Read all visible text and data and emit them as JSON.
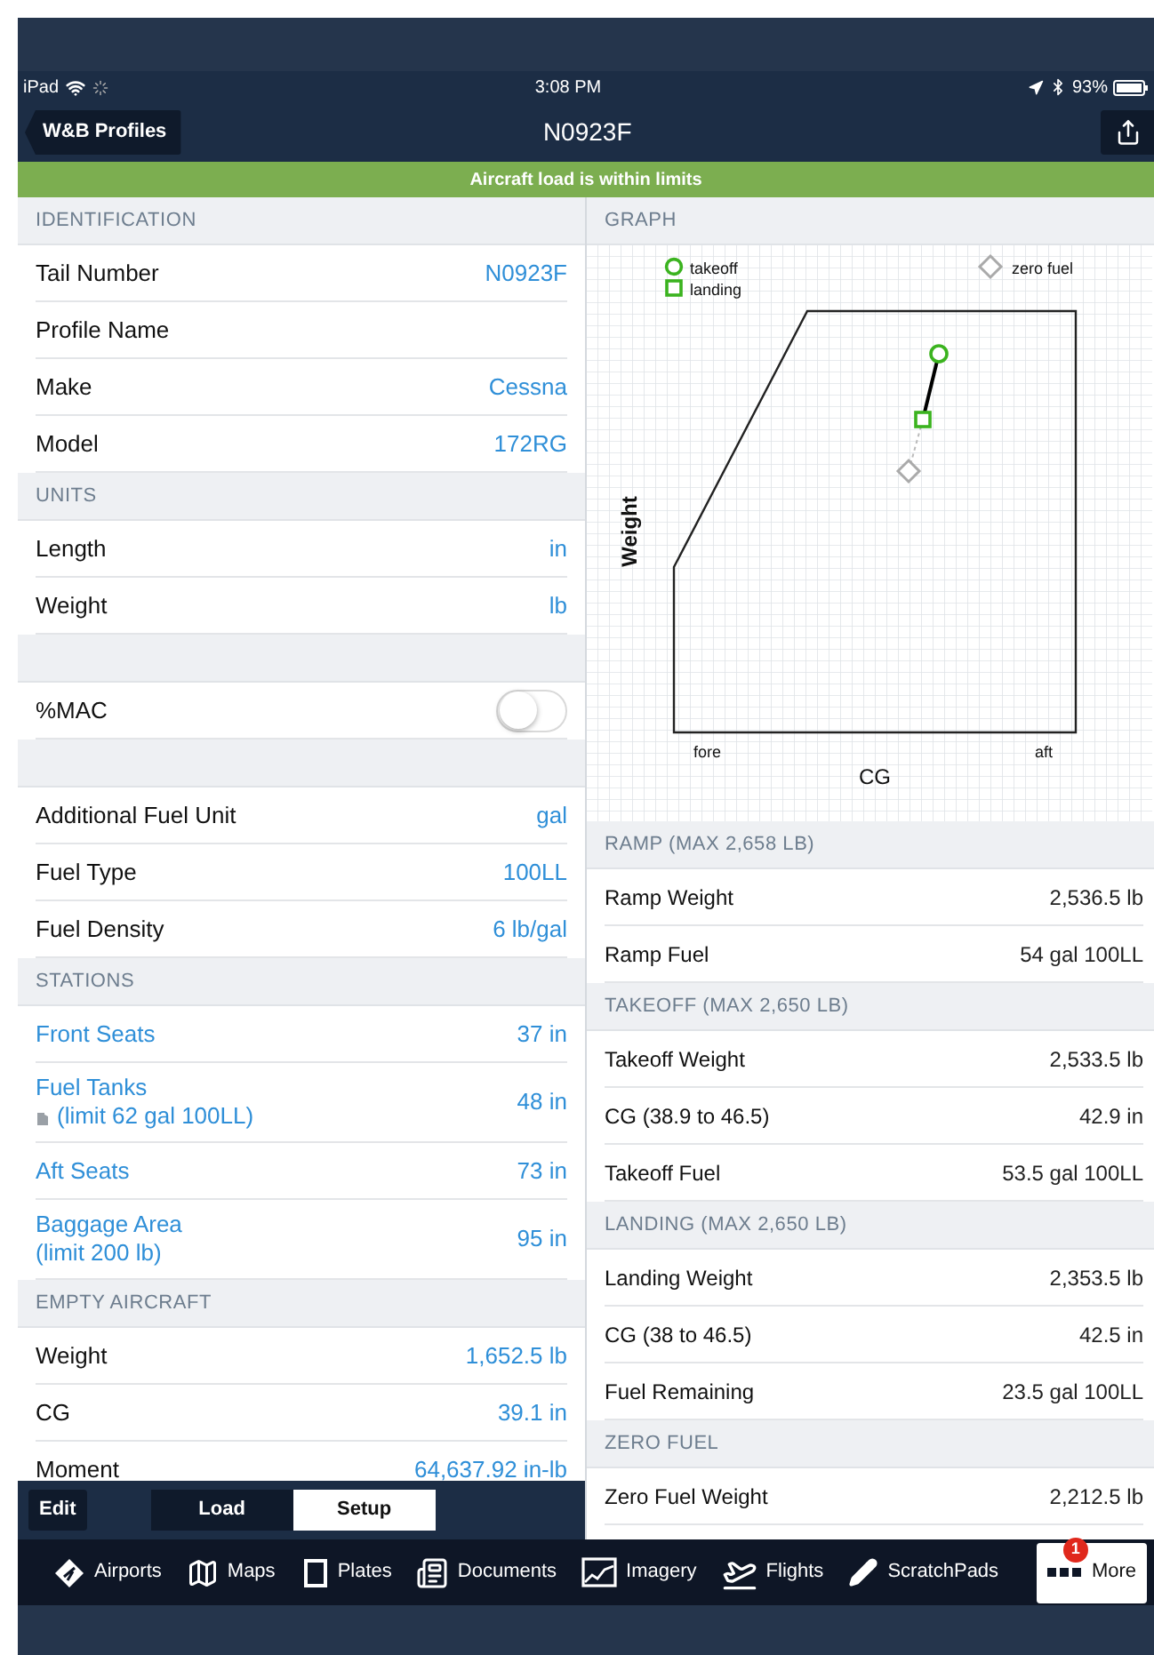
{
  "status_bar": {
    "device": "iPad",
    "time": "3:08 PM",
    "battery": "93%"
  },
  "nav": {
    "back": "W&B Profiles",
    "title": "N0923F"
  },
  "banner": "Aircraft load is within limits",
  "left_sections": [
    {
      "header": "IDENTIFICATION",
      "rows": [
        {
          "kind": "value",
          "label": "Tail Number",
          "value": "N0923F"
        },
        {
          "kind": "value",
          "label": "Profile Name"
        },
        {
          "kind": "value",
          "label": "Make",
          "value": "Cessna"
        },
        {
          "kind": "value",
          "label": "Model",
          "value": "172RG"
        }
      ]
    },
    {
      "header": "UNITS",
      "rows": [
        {
          "kind": "value",
          "label": "Length",
          "value": "in"
        },
        {
          "kind": "value",
          "label": "Weight",
          "value": "lb"
        }
      ]
    },
    {
      "rows": [
        {
          "kind": "toggle",
          "label": "%MAC",
          "on": false
        }
      ]
    },
    {
      "rows": [
        {
          "kind": "value",
          "label": "Additional Fuel Unit",
          "value": "gal"
        },
        {
          "kind": "value",
          "label": "Fuel Type",
          "value": "100LL"
        },
        {
          "kind": "value",
          "label": "Fuel Density",
          "value": "6 lb/gal"
        }
      ]
    },
    {
      "header": "STATIONS",
      "rows": [
        {
          "kind": "station",
          "label": "Front Seats",
          "value": "37 in"
        },
        {
          "kind": "station",
          "label": "Fuel Tanks",
          "note": "(limit 62 gal 100LL)",
          "note_icon": true,
          "value": "48 in"
        },
        {
          "kind": "station",
          "label": "Aft Seats",
          "value": "73 in"
        },
        {
          "kind": "station",
          "label": "Baggage Area",
          "note": "(limit 200 lb)",
          "note_icon": false,
          "value": "95 in"
        }
      ]
    },
    {
      "header": "EMPTY AIRCRAFT",
      "rows": [
        {
          "kind": "value",
          "label": "Weight",
          "value": "1,652.5 lb"
        },
        {
          "kind": "value",
          "label": "CG",
          "value": "39.1 in"
        },
        {
          "kind": "value",
          "label": "Moment",
          "value": "64,637.92 in-lb"
        }
      ]
    }
  ],
  "graph": {
    "header": "GRAPH",
    "legend": [
      "takeoff",
      "landing",
      "zero fuel"
    ],
    "ylabel": "Weight",
    "xlabel": "CG",
    "fore": "fore",
    "aft": "aft"
  },
  "right_sections": [
    {
      "header": "RAMP (MAX 2,658 LB)",
      "rows": [
        {
          "label": "Ramp Weight",
          "value": "2,536.5 lb"
        },
        {
          "label": "Ramp Fuel",
          "value": "54 gal 100LL"
        }
      ]
    },
    {
      "header": "TAKEOFF (MAX 2,650 LB)",
      "rows": [
        {
          "label": "Takeoff Weight",
          "value": "2,533.5 lb"
        },
        {
          "label": "CG (38.9 to 46.5)",
          "value": "42.9 in"
        },
        {
          "label": "Takeoff Fuel",
          "value": "53.5 gal 100LL"
        }
      ]
    },
    {
      "header": "LANDING (MAX 2,650 LB)",
      "rows": [
        {
          "label": "Landing Weight",
          "value": "2,353.5 lb"
        },
        {
          "label": "CG (38 to 46.5)",
          "value": "42.5 in"
        },
        {
          "label": "Fuel Remaining",
          "value": "23.5 gal 100LL"
        }
      ]
    },
    {
      "header": "ZERO FUEL",
      "rows": [
        {
          "label": "Zero Fuel Weight",
          "value": "2,212.5 lb"
        }
      ]
    }
  ],
  "toolbar": {
    "edit": "Edit",
    "segments": [
      {
        "label": "Load",
        "selected": false
      },
      {
        "label": "Setup",
        "selected": true
      }
    ]
  },
  "tabs": [
    {
      "label": "Airports",
      "selected": false
    },
    {
      "label": "Maps",
      "selected": false
    },
    {
      "label": "Plates",
      "selected": false
    },
    {
      "label": "Documents",
      "selected": false
    },
    {
      "label": "Imagery",
      "selected": false
    },
    {
      "label": "Flights",
      "selected": false
    },
    {
      "label": "ScratchPads",
      "selected": false
    },
    {
      "label": "More",
      "selected": true,
      "badge": "1"
    }
  ]
}
